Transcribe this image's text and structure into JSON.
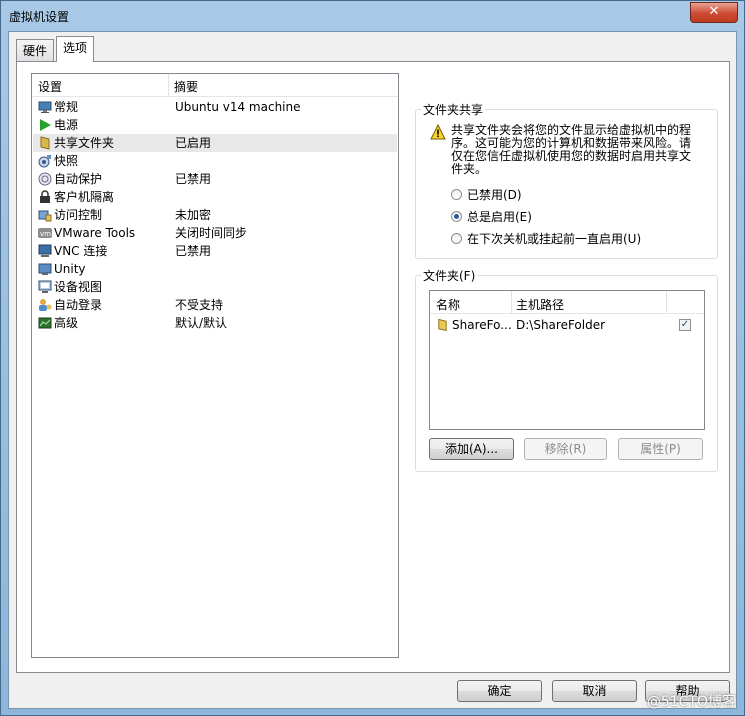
{
  "window": {
    "title": "虚拟机设置",
    "close_symbol": "✕"
  },
  "tabs": [
    {
      "label": "硬件",
      "active": false
    },
    {
      "label": "选项",
      "active": true
    }
  ],
  "settings_list": {
    "headers": {
      "setting": "设置",
      "summary": "摘要"
    },
    "items": [
      {
        "name": "常规",
        "summary": "Ubuntu v14 machine",
        "icon": "monitor-icon"
      },
      {
        "name": "电源",
        "summary": "",
        "icon": "play-icon"
      },
      {
        "name": "共享文件夹",
        "summary": "已启用",
        "icon": "shared-folder-icon",
        "selected": true
      },
      {
        "name": "快照",
        "summary": "",
        "icon": "snapshot-icon"
      },
      {
        "name": "自动保护",
        "summary": "已禁用",
        "icon": "autoprotect-icon"
      },
      {
        "name": "客户机隔离",
        "summary": "",
        "icon": "lock-icon"
      },
      {
        "name": "访问控制",
        "summary": "未加密",
        "icon": "access-control-icon"
      },
      {
        "name": "VMware Tools",
        "summary": "关闭时间同步",
        "icon": "vmware-tools-icon"
      },
      {
        "name": "VNC 连接",
        "summary": "已禁用",
        "icon": "vnc-icon"
      },
      {
        "name": "Unity",
        "summary": "",
        "icon": "unity-icon"
      },
      {
        "name": "设备视图",
        "summary": "",
        "icon": "device-view-icon"
      },
      {
        "name": "自动登录",
        "summary": "不受支持",
        "icon": "autologin-icon"
      },
      {
        "name": "高级",
        "summary": "默认/默认",
        "icon": "advanced-icon"
      }
    ]
  },
  "folder_sharing": {
    "group_title": "文件夹共享",
    "warning_text": "共享文件夹会将您的文件显示给虚拟机中的程序。这可能为您的计算机和数据带来风险。请仅在您信任虚拟机使用您的数据时启用共享文件夹。",
    "options": [
      {
        "label": "已禁用(D)",
        "selected": false
      },
      {
        "label": "总是启用(E)",
        "selected": true
      },
      {
        "label": "在下次关机或挂起前一直启用(U)",
        "selected": false
      }
    ]
  },
  "folders": {
    "group_title": "文件夹(F)",
    "headers": {
      "name": "名称",
      "host_path": "主机路径"
    },
    "rows": [
      {
        "name": "ShareFo...",
        "host_path": "D:\\ShareFolder",
        "enabled": true
      }
    ],
    "buttons": {
      "add": "添加(A)...",
      "remove": "移除(R)",
      "properties": "属性(P)"
    }
  },
  "footer_buttons": {
    "ok": "确定",
    "cancel": "取消",
    "help": "帮助"
  },
  "watermark": "@51CTO博客",
  "colors": {
    "selected_row": "#e8e8e8",
    "title_bar": "#a8c8e6",
    "close_button": "#cc4b32"
  }
}
